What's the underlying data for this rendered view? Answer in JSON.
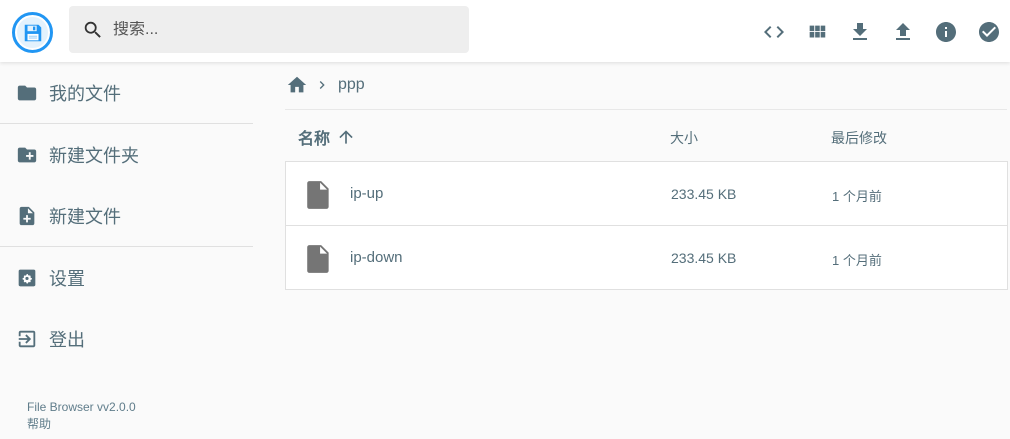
{
  "header": {
    "search_placeholder": "搜索...",
    "actions": [
      "code-icon",
      "grid-view-icon",
      "download-icon",
      "upload-icon",
      "info-icon",
      "check-circle-icon"
    ]
  },
  "sidebar": {
    "items": [
      {
        "label": "我的文件",
        "icon": "folder-icon"
      },
      {
        "label": "新建文件夹",
        "icon": "new-folder-icon"
      },
      {
        "label": "新建文件",
        "icon": "new-file-icon"
      },
      {
        "label": "设置",
        "icon": "settings-icon"
      },
      {
        "label": "登出",
        "icon": "logout-icon"
      }
    ],
    "version": "File Browser vv2.0.0",
    "help": "帮助"
  },
  "breadcrumb": {
    "current": "ppp"
  },
  "list": {
    "columns": {
      "name": "名称",
      "size": "大小",
      "modified": "最后修改"
    },
    "rows": [
      {
        "name": "ip-up",
        "size": "233.45 KB",
        "modified": "1 个月前"
      },
      {
        "name": "ip-down",
        "size": "233.45 KB",
        "modified": "1 个月前"
      }
    ]
  },
  "colors": {
    "accent": "#2196f3",
    "icon": "#546e7a",
    "file_icon": "#757575",
    "background": "#fafafa"
  }
}
